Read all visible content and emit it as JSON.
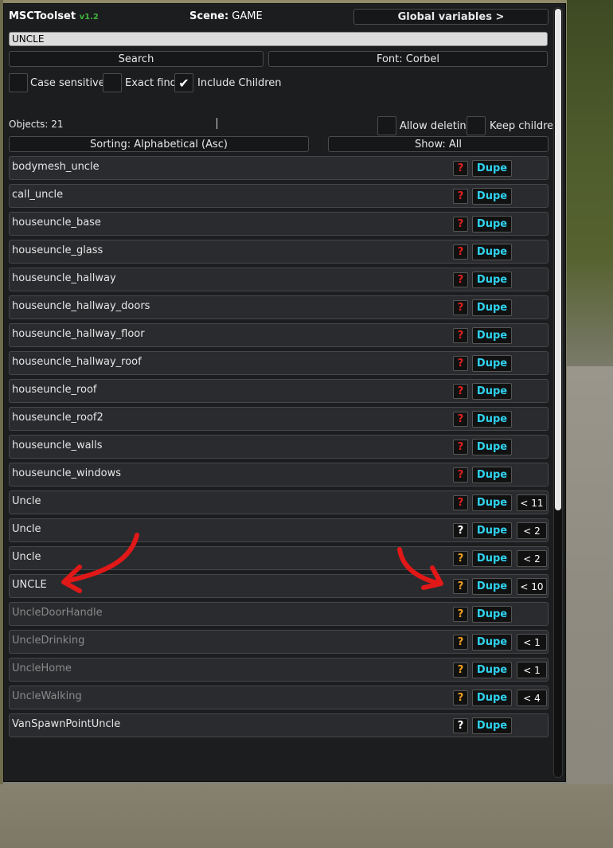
{
  "colors": {
    "version": "#3fb53f",
    "dupe": "#2fd3ef",
    "q_red": "#e02020",
    "q_white": "#ffffff",
    "q_orange": "#f0a020",
    "annotation": "#e01818"
  },
  "header": {
    "app_name": "MSCToolset",
    "version": "v1.2",
    "scene_label": "Scene:",
    "scene_value": "GAME",
    "global_button": "Global variables >"
  },
  "search": {
    "value": "UNCLE",
    "search_button": "Search",
    "font_button": "Font: Corbel"
  },
  "options": {
    "case_sensitive": {
      "label": "Case sensitive",
      "checked": false
    },
    "exact_find": {
      "label": "Exact find",
      "checked": false
    },
    "include_children": {
      "label": "Include Children",
      "checked": true
    },
    "allow_deleting": {
      "label": "Allow deleting",
      "checked": false
    },
    "keep_children": {
      "label": "Keep children",
      "checked": false
    },
    "check_glyph": "✔"
  },
  "objects_count": "Objects: 21",
  "sorting_button": "Sorting: Alphabetical (Asc)",
  "show_button": "Show: All",
  "rows": [
    {
      "name": "bodymesh_uncle",
      "q": "?",
      "q_color": "red",
      "dupe": "Dupe",
      "child": "",
      "inactive": false
    },
    {
      "name": "call_uncle",
      "q": "?",
      "q_color": "red",
      "dupe": "Dupe",
      "child": "",
      "inactive": false
    },
    {
      "name": "houseuncle_base",
      "q": "?",
      "q_color": "red",
      "dupe": "Dupe",
      "child": "",
      "inactive": false
    },
    {
      "name": "houseuncle_glass",
      "q": "?",
      "q_color": "red",
      "dupe": "Dupe",
      "child": "",
      "inactive": false
    },
    {
      "name": "houseuncle_hallway",
      "q": "?",
      "q_color": "red",
      "dupe": "Dupe",
      "child": "",
      "inactive": false
    },
    {
      "name": "houseuncle_hallway_doors",
      "q": "?",
      "q_color": "red",
      "dupe": "Dupe",
      "child": "",
      "inactive": false
    },
    {
      "name": "houseuncle_hallway_floor",
      "q": "?",
      "q_color": "red",
      "dupe": "Dupe",
      "child": "",
      "inactive": false
    },
    {
      "name": "houseuncle_hallway_roof",
      "q": "?",
      "q_color": "red",
      "dupe": "Dupe",
      "child": "",
      "inactive": false
    },
    {
      "name": "houseuncle_roof",
      "q": "?",
      "q_color": "red",
      "dupe": "Dupe",
      "child": "",
      "inactive": false
    },
    {
      "name": "houseuncle_roof2",
      "q": "?",
      "q_color": "red",
      "dupe": "Dupe",
      "child": "",
      "inactive": false
    },
    {
      "name": "houseuncle_walls",
      "q": "?",
      "q_color": "red",
      "dupe": "Dupe",
      "child": "",
      "inactive": false
    },
    {
      "name": "houseuncle_windows",
      "q": "?",
      "q_color": "red",
      "dupe": "Dupe",
      "child": "",
      "inactive": false
    },
    {
      "name": "Uncle",
      "q": "?",
      "q_color": "red",
      "dupe": "Dupe",
      "child": "< 11",
      "inactive": false
    },
    {
      "name": "Uncle",
      "q": "?",
      "q_color": "white",
      "dupe": "Dupe",
      "child": "< 2",
      "inactive": false
    },
    {
      "name": "Uncle",
      "q": "?",
      "q_color": "orange",
      "dupe": "Dupe",
      "child": "< 2",
      "inactive": false
    },
    {
      "name": "UNCLE",
      "q": "?",
      "q_color": "orange",
      "dupe": "Dupe",
      "child": "< 10",
      "inactive": false
    },
    {
      "name": "UncleDoorHandle",
      "q": "?",
      "q_color": "orange",
      "dupe": "Dupe",
      "child": "",
      "inactive": true
    },
    {
      "name": "UncleDrinking",
      "q": "?",
      "q_color": "orange",
      "dupe": "Dupe",
      "child": "< 1",
      "inactive": true
    },
    {
      "name": "UncleHome",
      "q": "?",
      "q_color": "orange",
      "dupe": "Dupe",
      "child": "< 1",
      "inactive": true
    },
    {
      "name": "UncleWalking",
      "q": "?",
      "q_color": "orange",
      "dupe": "Dupe",
      "child": "< 4",
      "inactive": true
    },
    {
      "name": "VanSpawnPointUncle",
      "q": "?",
      "q_color": "white",
      "dupe": "Dupe",
      "child": "",
      "inactive": false
    }
  ]
}
